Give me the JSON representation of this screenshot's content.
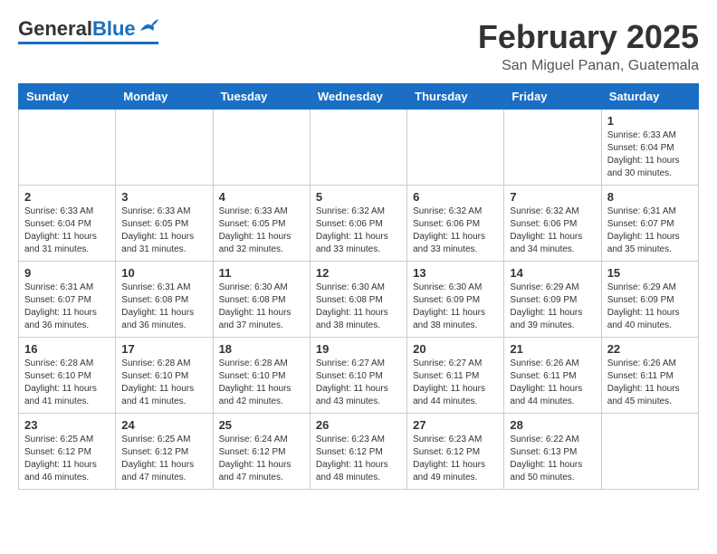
{
  "header": {
    "logo_general": "General",
    "logo_blue": "Blue",
    "month_title": "February 2025",
    "location": "San Miguel Panan, Guatemala"
  },
  "days_of_week": [
    "Sunday",
    "Monday",
    "Tuesday",
    "Wednesday",
    "Thursday",
    "Friday",
    "Saturday"
  ],
  "weeks": [
    [
      {
        "day": "",
        "info": ""
      },
      {
        "day": "",
        "info": ""
      },
      {
        "day": "",
        "info": ""
      },
      {
        "day": "",
        "info": ""
      },
      {
        "day": "",
        "info": ""
      },
      {
        "day": "",
        "info": ""
      },
      {
        "day": "1",
        "info": "Sunrise: 6:33 AM\nSunset: 6:04 PM\nDaylight: 11 hours\nand 30 minutes."
      }
    ],
    [
      {
        "day": "2",
        "info": "Sunrise: 6:33 AM\nSunset: 6:04 PM\nDaylight: 11 hours\nand 31 minutes."
      },
      {
        "day": "3",
        "info": "Sunrise: 6:33 AM\nSunset: 6:05 PM\nDaylight: 11 hours\nand 31 minutes."
      },
      {
        "day": "4",
        "info": "Sunrise: 6:33 AM\nSunset: 6:05 PM\nDaylight: 11 hours\nand 32 minutes."
      },
      {
        "day": "5",
        "info": "Sunrise: 6:32 AM\nSunset: 6:06 PM\nDaylight: 11 hours\nand 33 minutes."
      },
      {
        "day": "6",
        "info": "Sunrise: 6:32 AM\nSunset: 6:06 PM\nDaylight: 11 hours\nand 33 minutes."
      },
      {
        "day": "7",
        "info": "Sunrise: 6:32 AM\nSunset: 6:06 PM\nDaylight: 11 hours\nand 34 minutes."
      },
      {
        "day": "8",
        "info": "Sunrise: 6:31 AM\nSunset: 6:07 PM\nDaylight: 11 hours\nand 35 minutes."
      }
    ],
    [
      {
        "day": "9",
        "info": "Sunrise: 6:31 AM\nSunset: 6:07 PM\nDaylight: 11 hours\nand 36 minutes."
      },
      {
        "day": "10",
        "info": "Sunrise: 6:31 AM\nSunset: 6:08 PM\nDaylight: 11 hours\nand 36 minutes."
      },
      {
        "day": "11",
        "info": "Sunrise: 6:30 AM\nSunset: 6:08 PM\nDaylight: 11 hours\nand 37 minutes."
      },
      {
        "day": "12",
        "info": "Sunrise: 6:30 AM\nSunset: 6:08 PM\nDaylight: 11 hours\nand 38 minutes."
      },
      {
        "day": "13",
        "info": "Sunrise: 6:30 AM\nSunset: 6:09 PM\nDaylight: 11 hours\nand 38 minutes."
      },
      {
        "day": "14",
        "info": "Sunrise: 6:29 AM\nSunset: 6:09 PM\nDaylight: 11 hours\nand 39 minutes."
      },
      {
        "day": "15",
        "info": "Sunrise: 6:29 AM\nSunset: 6:09 PM\nDaylight: 11 hours\nand 40 minutes."
      }
    ],
    [
      {
        "day": "16",
        "info": "Sunrise: 6:28 AM\nSunset: 6:10 PM\nDaylight: 11 hours\nand 41 minutes."
      },
      {
        "day": "17",
        "info": "Sunrise: 6:28 AM\nSunset: 6:10 PM\nDaylight: 11 hours\nand 41 minutes."
      },
      {
        "day": "18",
        "info": "Sunrise: 6:28 AM\nSunset: 6:10 PM\nDaylight: 11 hours\nand 42 minutes."
      },
      {
        "day": "19",
        "info": "Sunrise: 6:27 AM\nSunset: 6:10 PM\nDaylight: 11 hours\nand 43 minutes."
      },
      {
        "day": "20",
        "info": "Sunrise: 6:27 AM\nSunset: 6:11 PM\nDaylight: 11 hours\nand 44 minutes."
      },
      {
        "day": "21",
        "info": "Sunrise: 6:26 AM\nSunset: 6:11 PM\nDaylight: 11 hours\nand 44 minutes."
      },
      {
        "day": "22",
        "info": "Sunrise: 6:26 AM\nSunset: 6:11 PM\nDaylight: 11 hours\nand 45 minutes."
      }
    ],
    [
      {
        "day": "23",
        "info": "Sunrise: 6:25 AM\nSunset: 6:12 PM\nDaylight: 11 hours\nand 46 minutes."
      },
      {
        "day": "24",
        "info": "Sunrise: 6:25 AM\nSunset: 6:12 PM\nDaylight: 11 hours\nand 47 minutes."
      },
      {
        "day": "25",
        "info": "Sunrise: 6:24 AM\nSunset: 6:12 PM\nDaylight: 11 hours\nand 47 minutes."
      },
      {
        "day": "26",
        "info": "Sunrise: 6:23 AM\nSunset: 6:12 PM\nDaylight: 11 hours\nand 48 minutes."
      },
      {
        "day": "27",
        "info": "Sunrise: 6:23 AM\nSunset: 6:12 PM\nDaylight: 11 hours\nand 49 minutes."
      },
      {
        "day": "28",
        "info": "Sunrise: 6:22 AM\nSunset: 6:13 PM\nDaylight: 11 hours\nand 50 minutes."
      },
      {
        "day": "",
        "info": ""
      }
    ]
  ]
}
